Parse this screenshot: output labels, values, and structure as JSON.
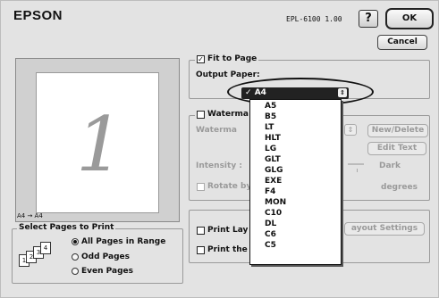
{
  "header": {
    "brand": "EPSON",
    "model": "EPL-6100  1.00",
    "help_label": "?",
    "ok_label": "OK",
    "cancel_label": "Cancel"
  },
  "preview": {
    "page_number": "1",
    "conversion_label": "A4 → A4"
  },
  "select_pages": {
    "legend": "Select Pages to Print",
    "options": [
      "All Pages in Range",
      "Odd Pages",
      "Even Pages"
    ],
    "selected": "All Pages in Range",
    "icon_pages": [
      "1",
      "2",
      "3",
      "4"
    ]
  },
  "fit_to_page": {
    "label": "Fit to Page",
    "checked": true,
    "output_paper_label": "Output Paper:",
    "selected_value": "A4",
    "options": [
      "A4",
      "A5",
      "B5",
      "LT",
      "HLT",
      "LG",
      "GLT",
      "GLG",
      "EXE",
      "F4",
      "MON",
      "C10",
      "DL",
      "C6",
      "C5"
    ]
  },
  "watermark": {
    "checkbox_label": "Waterma",
    "field_label": "Waterma",
    "new_delete_label": "New/Delete",
    "edit_text_label": "Edit Text",
    "intensity_label": "Intensity :",
    "dark_label": "Dark",
    "rotate_label": "Rotate by",
    "degrees_label": "degrees"
  },
  "layout": {
    "print_layout_label": "Print Lay",
    "print_the_label": "Print the",
    "layout_settings_label": "ayout Settings"
  },
  "colors": {
    "dialog_bg": "#e3e3e3",
    "highlight": "#222222"
  }
}
